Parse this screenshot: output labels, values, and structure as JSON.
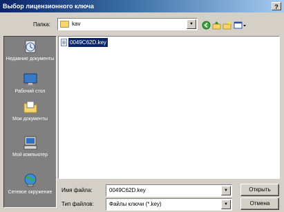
{
  "window": {
    "title": "Выбор лицензионного ключа",
    "help_label": "?"
  },
  "lookin": {
    "label": "Папка:",
    "value": "kav"
  },
  "toolbar": {
    "icons": [
      "back-icon",
      "up-folder-icon",
      "new-folder-icon",
      "view-menu-icon"
    ]
  },
  "places": [
    {
      "label": "Недавние документы",
      "icon": "recent-documents-icon"
    },
    {
      "label": "Рабочий стол",
      "icon": "desktop-icon"
    },
    {
      "label": "Мои документы",
      "icon": "my-documents-icon"
    },
    {
      "label": "Мой компьютер",
      "icon": "my-computer-icon"
    },
    {
      "label": "Сетевое окружение",
      "icon": "network-icon"
    }
  ],
  "files": [
    {
      "name": "0049C62D.key",
      "selected": true
    }
  ],
  "filename": {
    "label": "Имя файла:",
    "value": "0049C62D.key"
  },
  "filetype": {
    "label": "Тип файлов:",
    "value": "Файлы ключи (*.key)"
  },
  "buttons": {
    "open": "Открыть",
    "cancel": "Отмена"
  },
  "colors": {
    "titlebar": "#0a246a",
    "dialog": "#d4d0c8",
    "places_bar": "#808080",
    "selection": "#0a246a"
  }
}
